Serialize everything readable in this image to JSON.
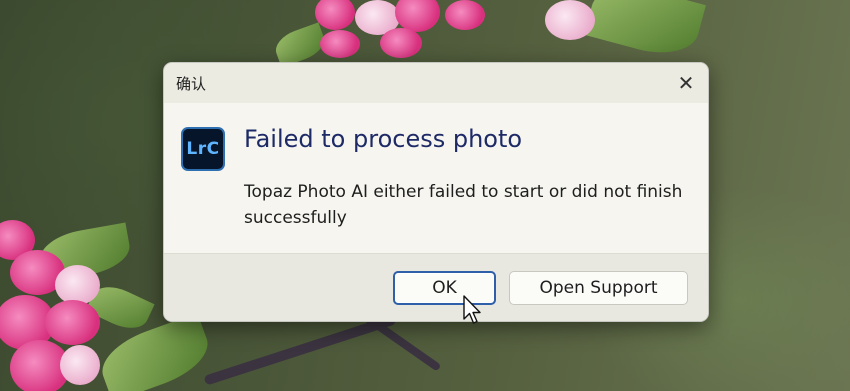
{
  "dialog": {
    "title": "确认",
    "close_symbol": "✕",
    "app_icon_text": "LrC",
    "headline": "Failed to process photo",
    "message": "Topaz Photo AI either failed to start or did not finish successfully"
  },
  "buttons": {
    "ok_label": "OK",
    "support_label": "Open Support"
  },
  "icons": {
    "close": "close-icon",
    "app": "lightroom-classic-icon",
    "cursor": "mouse-pointer-icon"
  },
  "colors": {
    "headline": "#1d2a66",
    "ok_border": "#2f5fa8",
    "app_icon_bg": "#07152a",
    "app_icon_text": "#5fb4ff"
  }
}
